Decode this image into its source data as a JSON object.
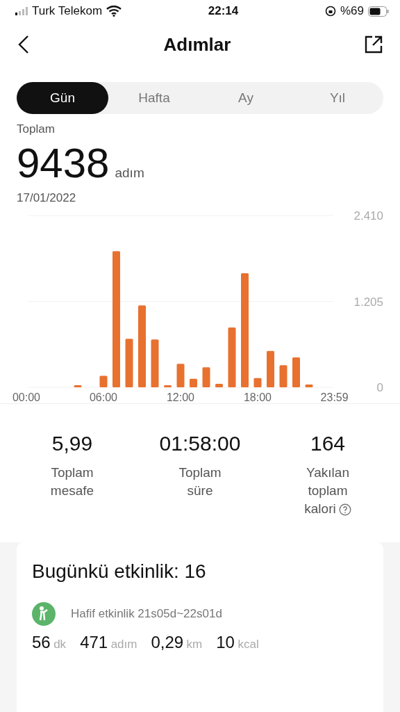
{
  "status_bar": {
    "carrier": "Turk Telekom",
    "time": "22:14",
    "battery": "%69"
  },
  "header": {
    "title": "Adımlar"
  },
  "tabs": [
    {
      "label": "Gün",
      "selected": true
    },
    {
      "label": "Hafta",
      "selected": false
    },
    {
      "label": "Ay",
      "selected": false
    },
    {
      "label": "Yıl",
      "selected": false
    }
  ],
  "summary": {
    "label": "Toplam",
    "value": "9438",
    "unit": "adım",
    "date": "17/01/2022"
  },
  "chart_data": {
    "type": "bar",
    "x": [
      0,
      1,
      2,
      3,
      4,
      5,
      6,
      7,
      8,
      9,
      10,
      11,
      12,
      13,
      14,
      15,
      16,
      17,
      18,
      19,
      20,
      21,
      22,
      23
    ],
    "series": [
      {
        "color": "#e8712f",
        "values": [
          0,
          0,
          0,
          0,
          20,
          0,
          160,
          1910,
          680,
          1150,
          670,
          30,
          330,
          120,
          280,
          50,
          840,
          1600,
          130,
          510,
          310,
          420,
          40,
          0
        ]
      }
    ],
    "xlim": [
      0,
      23.98
    ],
    "ylim": [
      0,
      2410
    ],
    "yticks": [
      {
        "value": 2410,
        "label": "2.410"
      },
      {
        "value": 1205,
        "label": "1.205"
      },
      {
        "value": 0,
        "label": "0"
      }
    ],
    "xticks": [
      {
        "value": 0,
        "label": "00:00"
      },
      {
        "value": 6,
        "label": "06:00"
      },
      {
        "value": 12,
        "label": "12:00"
      },
      {
        "value": 18,
        "label": "18:00"
      },
      {
        "value": 23.98,
        "label": "23:59"
      }
    ]
  },
  "stats": [
    {
      "value": "5,99",
      "label": "Toplam mesafe",
      "info": false
    },
    {
      "value": "01:58:00",
      "label": "Toplam süre",
      "info": false
    },
    {
      "value": "164",
      "label": "Yakılan toplam kalori",
      "info": true
    }
  ],
  "activity": {
    "title": "Bugünkü etkinlik: 16",
    "items": [
      {
        "description": "Hafif etkinlik 21s05d~22s01d",
        "metrics": [
          {
            "value": "56",
            "unit": "dk"
          },
          {
            "value": "471",
            "unit": "adım"
          },
          {
            "value": "0,29",
            "unit": "km"
          },
          {
            "value": "10",
            "unit": "kcal"
          }
        ]
      }
    ]
  }
}
